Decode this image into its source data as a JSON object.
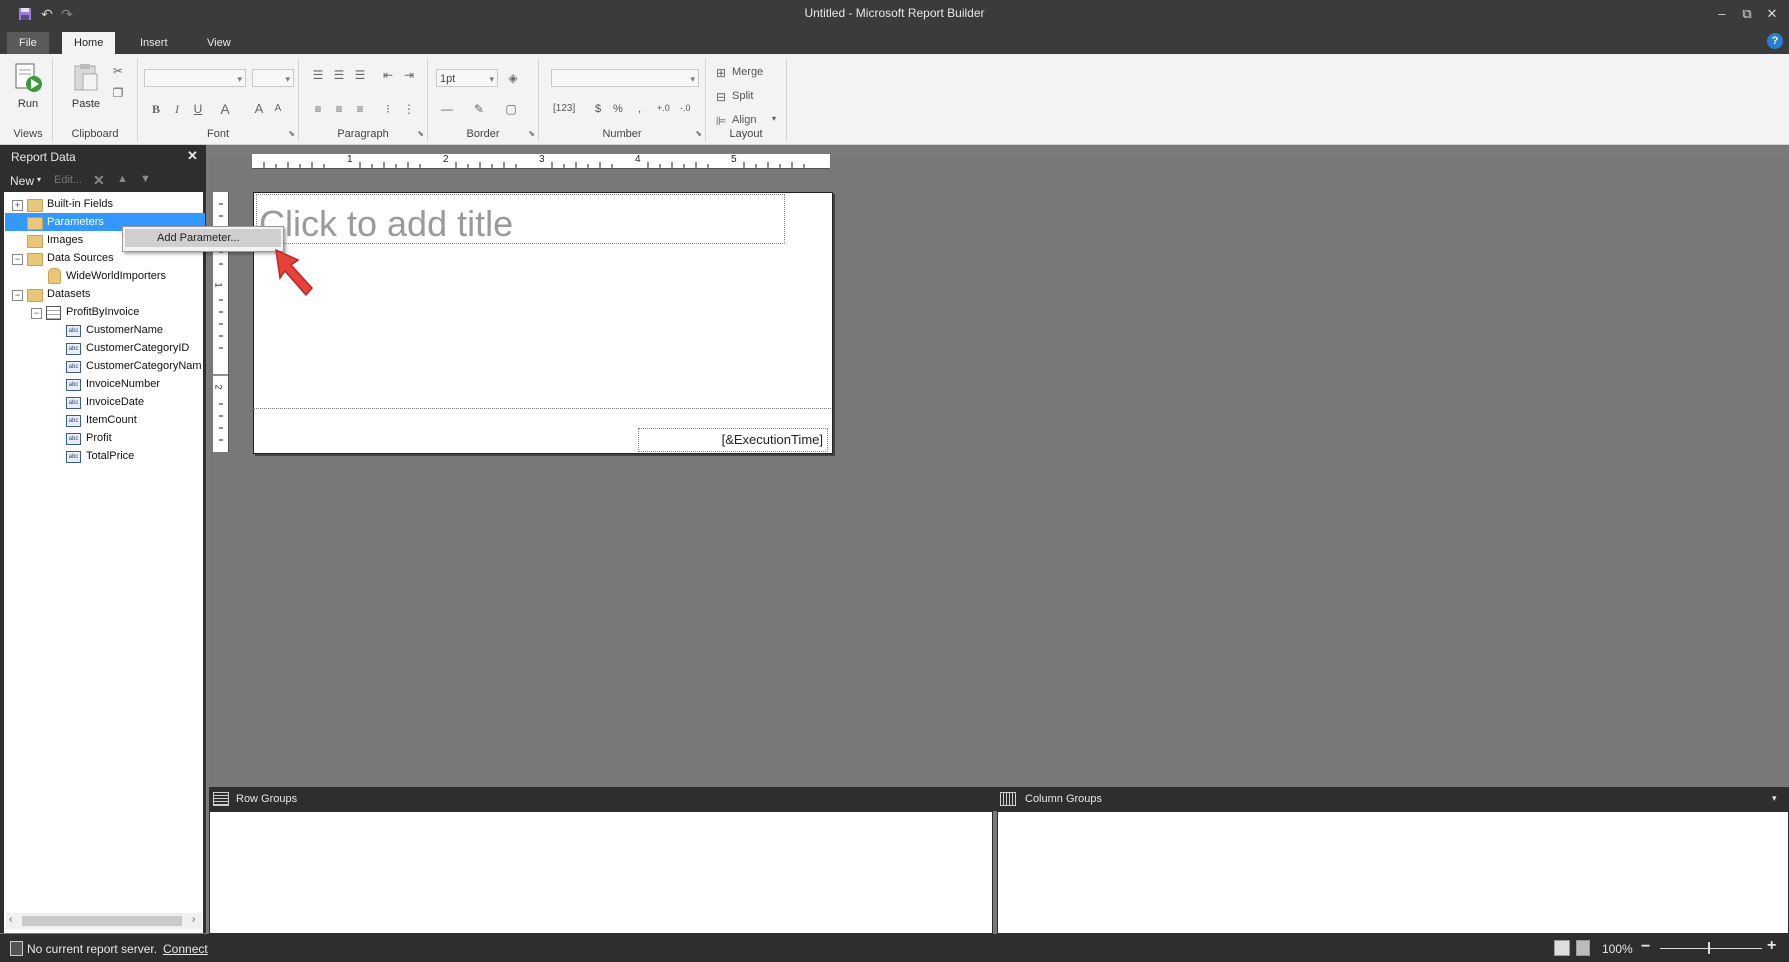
{
  "window": {
    "title": "Untitled - Microsoft Report Builder",
    "controls": {
      "minimize": "–",
      "restore": "⧉",
      "close": "✕"
    },
    "help": "?"
  },
  "tabs": [
    {
      "label": "File"
    },
    {
      "label": "Home"
    },
    {
      "label": "Insert"
    },
    {
      "label": "View"
    }
  ],
  "ribbon": {
    "views": {
      "run_label": "Run",
      "group_label": "Views"
    },
    "clipboard": {
      "paste_label": "Paste",
      "group_label": "Clipboard"
    },
    "font": {
      "group_label": "Font",
      "bold": "B",
      "italic": "I",
      "underline": "U",
      "color": "A",
      "size_up": "A"
    },
    "paragraph": {
      "group_label": "Paragraph"
    },
    "border": {
      "group_label": "Border",
      "width_value": "1pt"
    },
    "number": {
      "group_label": "Number",
      "currency": "$",
      "percent": "%",
      "comma": ",",
      "inc_dec": "+.0",
      "dec_dec": "-.0",
      "placeholder": "[123]"
    },
    "layout": {
      "group_label": "Layout",
      "merge": "Merge",
      "split": "Split",
      "align": "Align"
    }
  },
  "report_data": {
    "title": "Report Data",
    "close": "✕",
    "toolbar": {
      "new": "New",
      "edit": "Edit..."
    },
    "tree": {
      "builtin_fields": "Built-in Fields",
      "parameters": "Parameters",
      "images": "Images",
      "data_sources": "Data Sources",
      "data_source_item": "WideWorldImporters",
      "datasets": "Datasets",
      "dataset_item": "ProfitByInvoice",
      "fields": [
        "CustomerName",
        "CustomerCategoryID",
        "CustomerCategoryNam",
        "InvoiceNumber",
        "InvoiceDate",
        "ItemCount",
        "Profit",
        "TotalPrice"
      ]
    }
  },
  "context_menu": {
    "add_parameter": "Add Parameter..."
  },
  "design": {
    "title_placeholder": "Click to add title",
    "execution_time": "[&ExecutionTime]",
    "ruler_marks": [
      "1",
      "2",
      "3",
      "4",
      "5"
    ],
    "vruler_marks": [
      "1",
      "2"
    ]
  },
  "groups": {
    "row_groups": "Row Groups",
    "column_groups": "Column Groups"
  },
  "status": {
    "server_text": "No current report server.",
    "connect": "Connect",
    "zoom": "100%",
    "zoom_out": "−",
    "zoom_in": "+"
  },
  "colors": {
    "accent": "#2b7cd3",
    "selection": "#3399ff",
    "dark": "#2e2e2e",
    "arrow": "#e8403a"
  }
}
